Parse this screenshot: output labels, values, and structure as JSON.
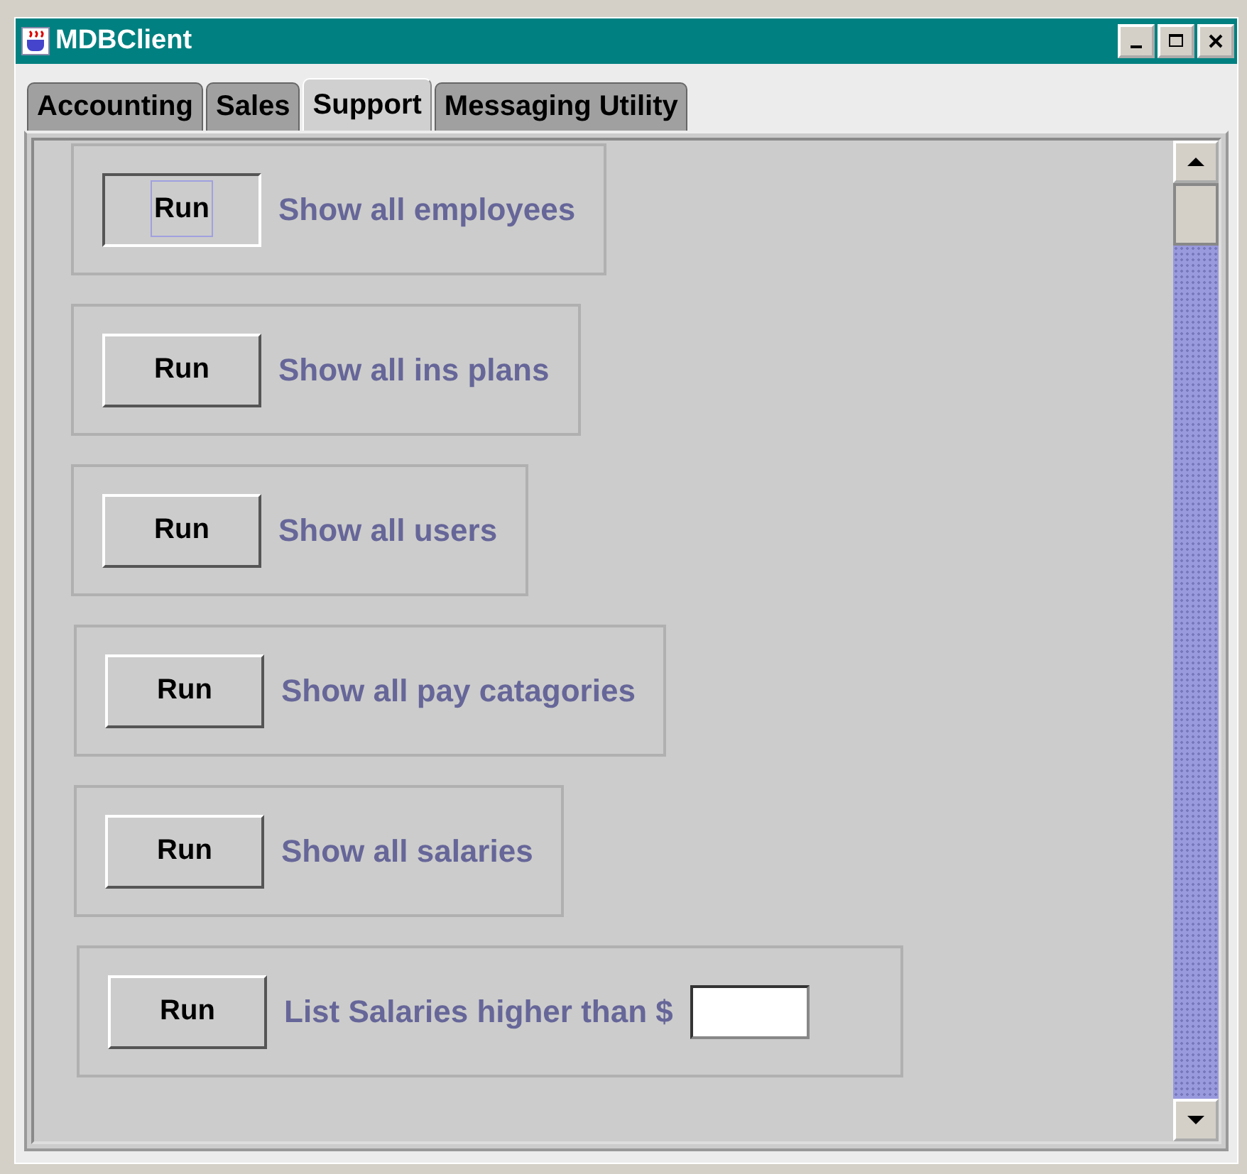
{
  "window": {
    "title": "MDBClient"
  },
  "tabs": [
    {
      "label": "Accounting",
      "selected": false
    },
    {
      "label": "Sales",
      "selected": false
    },
    {
      "label": "Support",
      "selected": true
    },
    {
      "label": "Messaging Utility",
      "selected": false
    }
  ],
  "queries": [
    {
      "button": "Run",
      "focused": true,
      "label": "Show all employees"
    },
    {
      "button": "Run",
      "focused": false,
      "label": "Show all ins plans"
    },
    {
      "button": "Run",
      "focused": false,
      "label": "Show all users"
    },
    {
      "button": "Run",
      "focused": false,
      "label": "Show all pay catagories"
    },
    {
      "button": "Run",
      "focused": false,
      "label": "Show all salaries"
    },
    {
      "button": "Run",
      "focused": false,
      "label": "List Salaries higher than $",
      "kind": "input"
    }
  ]
}
